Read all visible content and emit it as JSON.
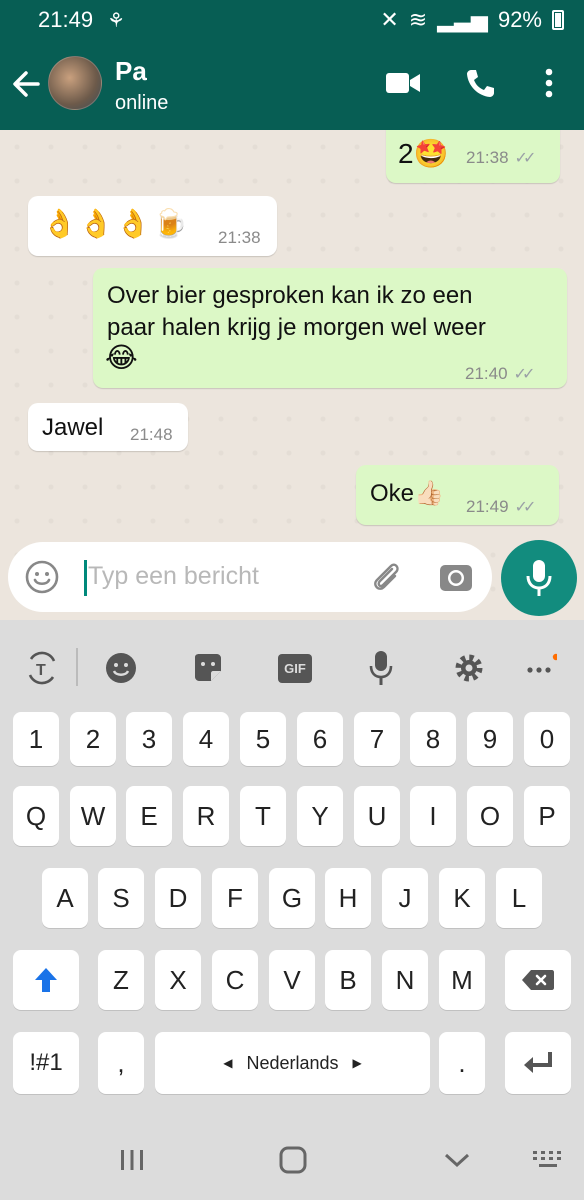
{
  "status_bar": {
    "time": "21:49",
    "battery": "92%"
  },
  "header": {
    "name": "Pa",
    "status": "online"
  },
  "messages": [
    {
      "type": "out",
      "text": "2🤩",
      "time": "21:38"
    },
    {
      "type": "in",
      "text": "👌👌👌🍺",
      "time": "21:38"
    },
    {
      "type": "out",
      "text": "Over bier gesproken kan ik zo een paar halen krijg je morgen wel weer",
      "text2": "😂",
      "time": "21:40"
    },
    {
      "type": "in",
      "text": "Jawel",
      "time": "21:48"
    },
    {
      "type": "out",
      "text": "Oke👍🏻",
      "time": "21:49"
    }
  ],
  "composer": {
    "placeholder": "Typ een bericht"
  },
  "keyboard": {
    "toolbar_gif": "GIF",
    "number_row": [
      "1",
      "2",
      "3",
      "4",
      "5",
      "6",
      "7",
      "8",
      "9",
      "0"
    ],
    "row1": [
      "Q",
      "W",
      "E",
      "R",
      "T",
      "Y",
      "U",
      "I",
      "O",
      "P"
    ],
    "row2": [
      "A",
      "S",
      "D",
      "F",
      "G",
      "H",
      "J",
      "K",
      "L"
    ],
    "row3": [
      "Z",
      "X",
      "C",
      "V",
      "B",
      "N",
      "M"
    ],
    "symbols": "!#1",
    "comma": ",",
    "period": ".",
    "language": "Nederlands"
  }
}
